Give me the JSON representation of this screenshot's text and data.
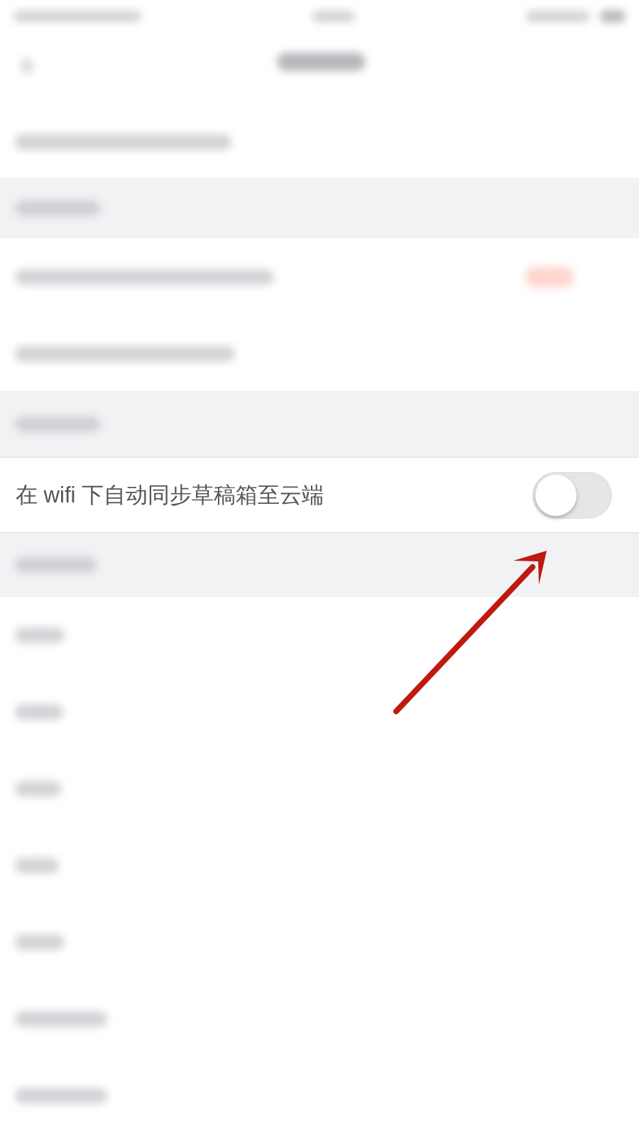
{
  "setting": {
    "label": "在 wifi 下自动同步草稿箱至云端",
    "on": false
  },
  "annotations": [
    {
      "kind": "arrow"
    }
  ]
}
